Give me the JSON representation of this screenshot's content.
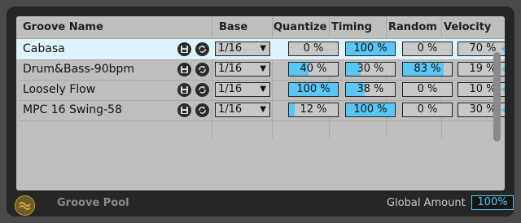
{
  "header": {
    "groove_name": "Groove Name",
    "base": "Base",
    "quantize": "Quantize",
    "timing": "Timing",
    "random": "Random",
    "velocity": "Velocity"
  },
  "rows": [
    {
      "name": "Cabasa",
      "base": "1/16",
      "quantize": "0 %",
      "quantize_fill": 0,
      "timing": "100 %",
      "timing_fill": 1,
      "random": "0 %",
      "random_fill": 0,
      "velocity": "70 %",
      "velocity_fill": 0
    },
    {
      "name": "Drum&Bass-90bpm",
      "base": "1/16",
      "quantize": "40 %",
      "quantize_fill": 0.4,
      "timing": "30 %",
      "timing_fill": 0.3,
      "random": "83 %",
      "random_fill": 0.83,
      "velocity": "19 %",
      "velocity_fill": 0
    },
    {
      "name": "Loosely Flow",
      "base": "1/16",
      "quantize": "100 %",
      "quantize_fill": 1,
      "timing": "38 %",
      "timing_fill": 0.38,
      "random": "0 %",
      "random_fill": 0,
      "velocity": "10 %",
      "velocity_fill": 0
    },
    {
      "name": "MPC 16 Swing-58",
      "base": "1/16",
      "quantize": "12 %",
      "quantize_fill": 0.12,
      "timing": "100 %",
      "timing_fill": 1,
      "random": "0 %",
      "random_fill": 0,
      "velocity": "30 %",
      "velocity_fill": 0
    }
  ],
  "icons": {
    "save": "save-icon",
    "commit": "commit-icon",
    "pool_toggle": "wave-icon"
  },
  "footer": {
    "title": "Groove Pool",
    "global_amount_label": "Global Amount",
    "global_amount_value": "100%"
  },
  "colors": {
    "accent": "#5ac6f4",
    "selected_row": "#dff3fd",
    "panel": "#bebebe",
    "brand_orange": "#c89a2e"
  }
}
